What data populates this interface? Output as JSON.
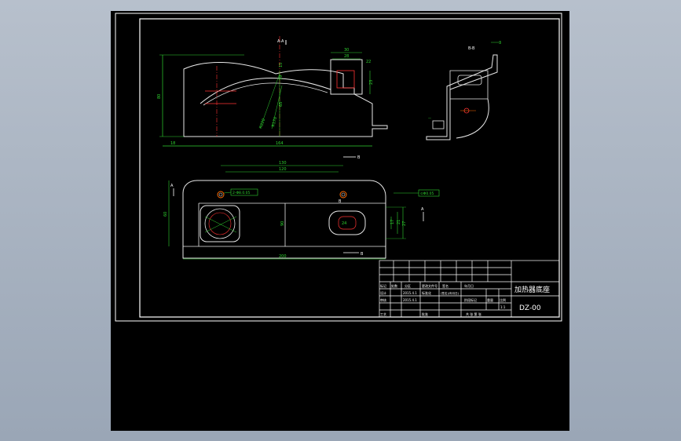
{
  "colors": {
    "background": "#000000",
    "frame": "#ffffff",
    "outline": "#ffffff",
    "dimension": "#2fd32f",
    "part": "#e8e8e8",
    "hidden": "#ff3333",
    "center": "#ff6a00",
    "title_text": "#ffffff"
  },
  "section_marks": {
    "aa_top": "A-A",
    "bb_top": "B-B",
    "b_right": "B",
    "a_left": "A",
    "a_right": "A",
    "b_bottom": "B"
  },
  "view1_dims": {
    "d80": "80",
    "d15": "15",
    "d19": "19",
    "d65": "65",
    "r220": "R220",
    "r170": "R170",
    "d18": "18",
    "d164": "164",
    "d30": "30",
    "d28": "28",
    "d23": "23",
    "d22": "22"
  },
  "view2_dims": {
    "d3": "3"
  },
  "view3_dims": {
    "d130": "130",
    "d120": "120",
    "d60": "60",
    "d90": "90",
    "d200": "200",
    "d17": "17",
    "d21": "21",
    "d27": "27",
    "d24": "24",
    "callout_left": "2-Φ8.0.05",
    "callout_right": "⊙Φ0.05",
    "hole_label": "B"
  },
  "title_block": {
    "part_name": "加热器底座",
    "drawing_no": "DZ-00",
    "scale": "1:1",
    "date1": "2015.4.1",
    "date2": "2015.4.1",
    "row1": [
      "标记",
      "处数",
      "分区",
      "更改文件号",
      "签名",
      "年月日"
    ],
    "row2_left": "设计",
    "row2_std": "标准化",
    "row2_mid": "阶段标记",
    "row2_weight": "重量",
    "row2_scale": "比例",
    "row3_left": "审核",
    "row4_left": "工艺",
    "row4_approve": "批准",
    "sheets": "共 张  第 张",
    "std_code": "(签名)(年月日)"
  }
}
